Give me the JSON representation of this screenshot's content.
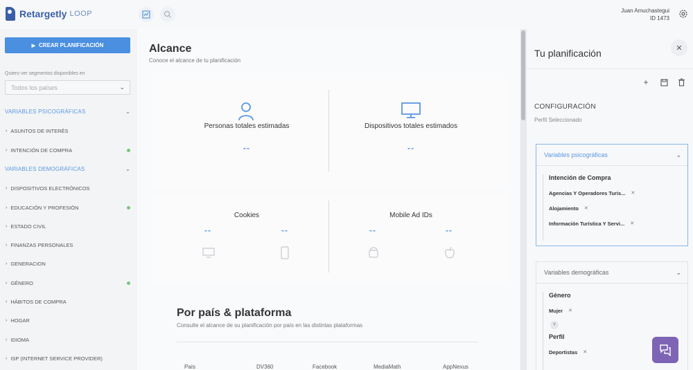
{
  "app": {
    "brand": "Retargetly",
    "product": "LOOP"
  },
  "topbar": {
    "icons": [
      "chart-icon",
      "search-icon"
    ],
    "user_name": "Juan Amuchastegui",
    "user_id": "ID 1473"
  },
  "sidebar": {
    "create_label": "CREAR PLANIFICACIÓN",
    "segments_label": "Quiero ver segmentos disponibles en",
    "country_placeholder": "Todos los países",
    "groups": [
      {
        "label": "VARIABLES PSICOGRÁFICAS"
      },
      {
        "label": "VARIABLES DEMOGRÁFICAS"
      }
    ],
    "items": [
      {
        "label": "ASUNTOS DE INTERÉS",
        "dot": false
      },
      {
        "label": "INTENCIÓN DE COMPRA",
        "dot": true
      },
      {
        "label": "DISPOSITIVOS ELECTRÓNICOS",
        "dot": false
      },
      {
        "label": "EDUCACIÓN Y PROFESIÓN",
        "dot": true
      },
      {
        "label": "ESTADO CIVIL",
        "dot": false
      },
      {
        "label": "FINANZAS PERSONALES",
        "dot": false
      },
      {
        "label": "GENERACION",
        "dot": false
      },
      {
        "label": "GÉNERO",
        "dot": true
      },
      {
        "label": "HÁBITOS DE COMPRA",
        "dot": false
      },
      {
        "label": "HOGAR",
        "dot": false
      },
      {
        "label": "IDIOMA",
        "dot": false
      },
      {
        "label": "ISP (INTERNET SERVICE PROVIDER)",
        "dot": false
      }
    ]
  },
  "main": {
    "title": "Alcance",
    "subtitle": "Conoce el alcance de tu planificación",
    "stats": {
      "people_title": "Personas totales estimadas",
      "people_value": "--",
      "devices_title": "Dispositivos totales estimados",
      "devices_value": "--",
      "cookies_title": "Cookies",
      "cookies_desktop": "--",
      "cookies_mobile": "--",
      "maid_title": "Mobile Ad IDs",
      "maid_android": "--",
      "maid_ios": "--"
    },
    "country_section": {
      "title": "Por país & plataforma",
      "subtitle": "Consulte el alcance de su planificación por país en las distintas plataformas",
      "columns": [
        "País",
        "DV360",
        "Facebook",
        "MediaMath",
        "AppNexus"
      ]
    }
  },
  "panel": {
    "title": "Tu planificación",
    "config_title": "CONFIGURACIÓN",
    "config_sub": "Perfil Seleccionado",
    "psico": {
      "header": "Variables psicográficas",
      "criteria_title": "Intención de Compra",
      "tags": [
        "Agencias Y Operadores Turis...",
        "Alojamiento",
        "Información Turística Y Servi..."
      ]
    },
    "demo": {
      "header": "Variables demográficas",
      "crit1_title": "Género",
      "crit1_tags": [
        "Mujer"
      ],
      "and_label": "Y",
      "crit2_title": "Perfil",
      "crit2_tags": [
        "Deportistas"
      ]
    }
  },
  "colors": {
    "accent": "#4a8fe0",
    "link": "#5a97e0",
    "dot": "#7bc47f",
    "chat": "#7e64b5"
  }
}
